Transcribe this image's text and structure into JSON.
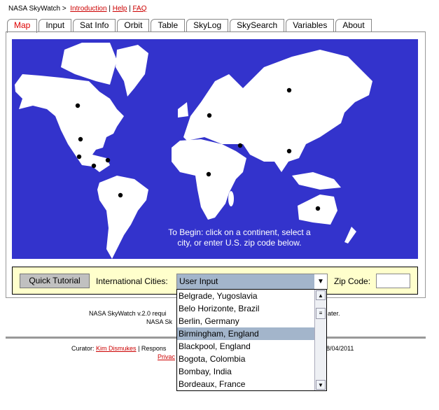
{
  "breadcrumb": {
    "site": "NASA SkyWatch >",
    "links": [
      "Introduction",
      "Help",
      "FAQ"
    ],
    "sep": "|"
  },
  "tabs": [
    {
      "label": "Map",
      "active": true
    },
    {
      "label": "Input"
    },
    {
      "label": "Sat Info"
    },
    {
      "label": "Orbit"
    },
    {
      "label": "Table"
    },
    {
      "label": "SkyLog"
    },
    {
      "label": "SkySearch"
    },
    {
      "label": "Variables"
    },
    {
      "label": "About"
    }
  ],
  "map": {
    "instruction_line1": "To Begin: click on a continent, select a",
    "instruction_line2": "city, or enter U.S. zip code below.",
    "ocean_color": "#3333cc",
    "land_color": "#ffffff",
    "city_marker_color": "#000000"
  },
  "controls": {
    "tutorial_label": "Quick Tutorial",
    "cities_label": "International Cities:",
    "cities_selected": "User Input",
    "zip_label": "Zip Code:",
    "zip_value": ""
  },
  "dropdown": {
    "options": [
      "Belgrade, Yugoslavia",
      "Belo Horizonte, Brazil",
      "Berlin, Germany",
      "Birmingham, England",
      "Blackpool, England",
      "Bogota, Colombia",
      "Bombay, India",
      "Bordeaux, France"
    ],
    "highlighted": "Birmingham, England"
  },
  "footer": {
    "line1_left": "NASA SkyWatch v.2.0 requi",
    "line1_right": "ater.",
    "line2_left": "NASA Sk",
    "curator_label": "Curator:",
    "curator_name": "Kim Dismukes",
    "responsible": "| Respons",
    "date": "8/04/2011",
    "privacy": "Privac"
  }
}
